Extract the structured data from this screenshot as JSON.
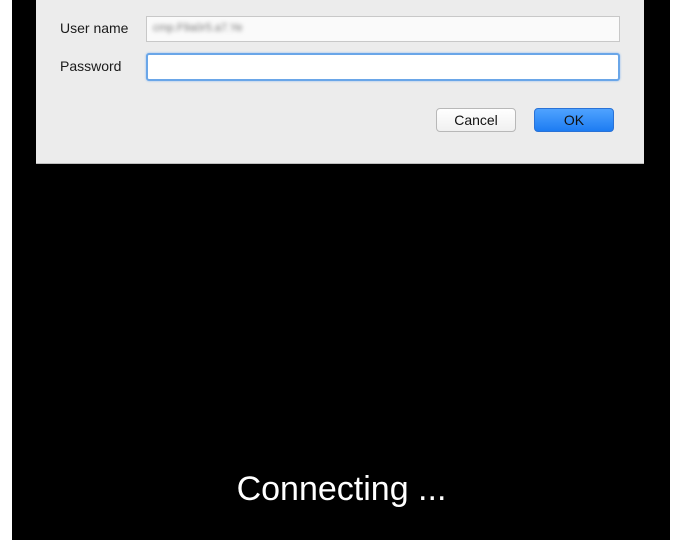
{
  "dialog": {
    "username_label": "User name",
    "username_value": "cmp.F9a0r5.a7.Ye",
    "password_label": "Password",
    "password_value": "",
    "cancel_label": "Cancel",
    "ok_label": "OK"
  },
  "status": {
    "message": "Connecting ..."
  },
  "colors": {
    "background": "#000000",
    "dialog": "#ececec",
    "ok_button": "#1d7cf2",
    "focus_ring": "#6aa6e8"
  }
}
